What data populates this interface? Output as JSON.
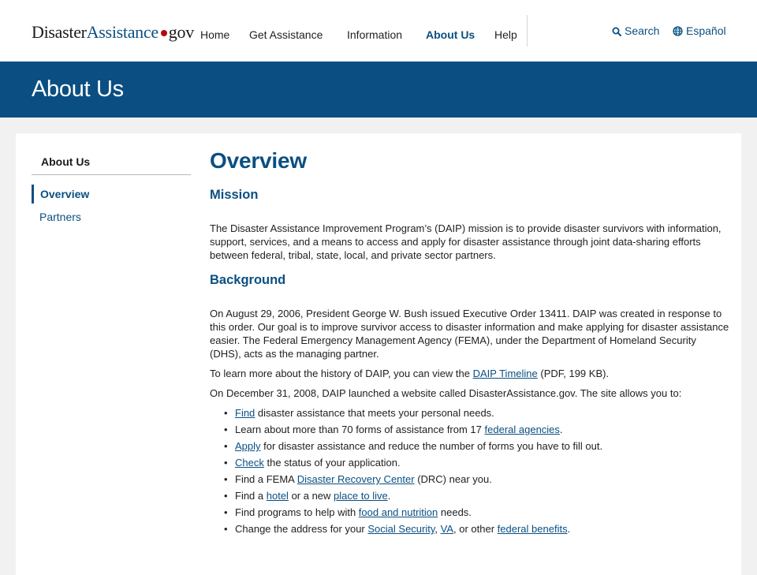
{
  "header": {
    "logo": {
      "part1": "Disaster",
      "part2": "Assistance",
      "part3": "gov"
    },
    "nav": [
      "Home",
      "Get Assistance",
      "Information",
      "About Us",
      "Help"
    ],
    "active_nav": "About Us",
    "search_label": "Search",
    "language_label": "Español"
  },
  "banner": {
    "title": "About Us"
  },
  "sidebar": {
    "title": "About Us",
    "items": [
      {
        "label": "Overview",
        "current": true
      },
      {
        "label": "Partners",
        "current": false
      }
    ]
  },
  "content": {
    "title": "Overview",
    "mission_heading": "Mission",
    "mission_text": "The Disaster Assistance Improvement Program’s (DAIP) mission is to provide disaster survivors with information, support, services, and a means to access and apply for disaster assistance through joint data-sharing efforts between federal, tribal, state, local, and private sector partners.",
    "background_heading": "Background",
    "background_text": "On August 29, 2006, President George W. Bush issued Executive Order 13411. DAIP was created in response to this order. Our goal is to improve survivor access to disaster information and make applying for disaster assistance easier. The Federal Emergency Management Agency (FEMA), under the Department of Homeland Security (DHS), acts as the managing partner.",
    "timeline": {
      "before": "To learn more about the history of DAIP, you can view the ",
      "link": "DAIP Timeline",
      "after": " (PDF, 199 KB)."
    },
    "launch_text": "On December 31, 2008, DAIP launched a website called DisasterAssistance.gov. The site allows you to:",
    "bullets": [
      {
        "link": "Find",
        "text": " disaster assistance that meets your personal needs."
      },
      {
        "pre": "Learn about more than 70 forms of assistance from 17 ",
        "link": "federal agencies",
        "post": "."
      },
      {
        "link": "Apply",
        "text": " for disaster assistance and reduce the number of forms you have to fill out."
      },
      {
        "link": "Check",
        "text": " the status of your application."
      },
      {
        "pre": "Find a FEMA ",
        "link": "Disaster Recovery Center",
        "post": " (DRC) near you."
      },
      {
        "pre": "Find a ",
        "link": "hotel",
        "mid": " or a new ",
        "link2": "place to live",
        "post": "."
      },
      {
        "pre": "Find programs to help with ",
        "link": "food and nutrition",
        "post": " needs."
      },
      {
        "pre": "Change the address for your ",
        "link": "Social Security",
        "mid": ", ",
        "link2": "VA",
        "mid2": ", or other ",
        "link3": "federal benefits",
        "post": "."
      }
    ]
  }
}
